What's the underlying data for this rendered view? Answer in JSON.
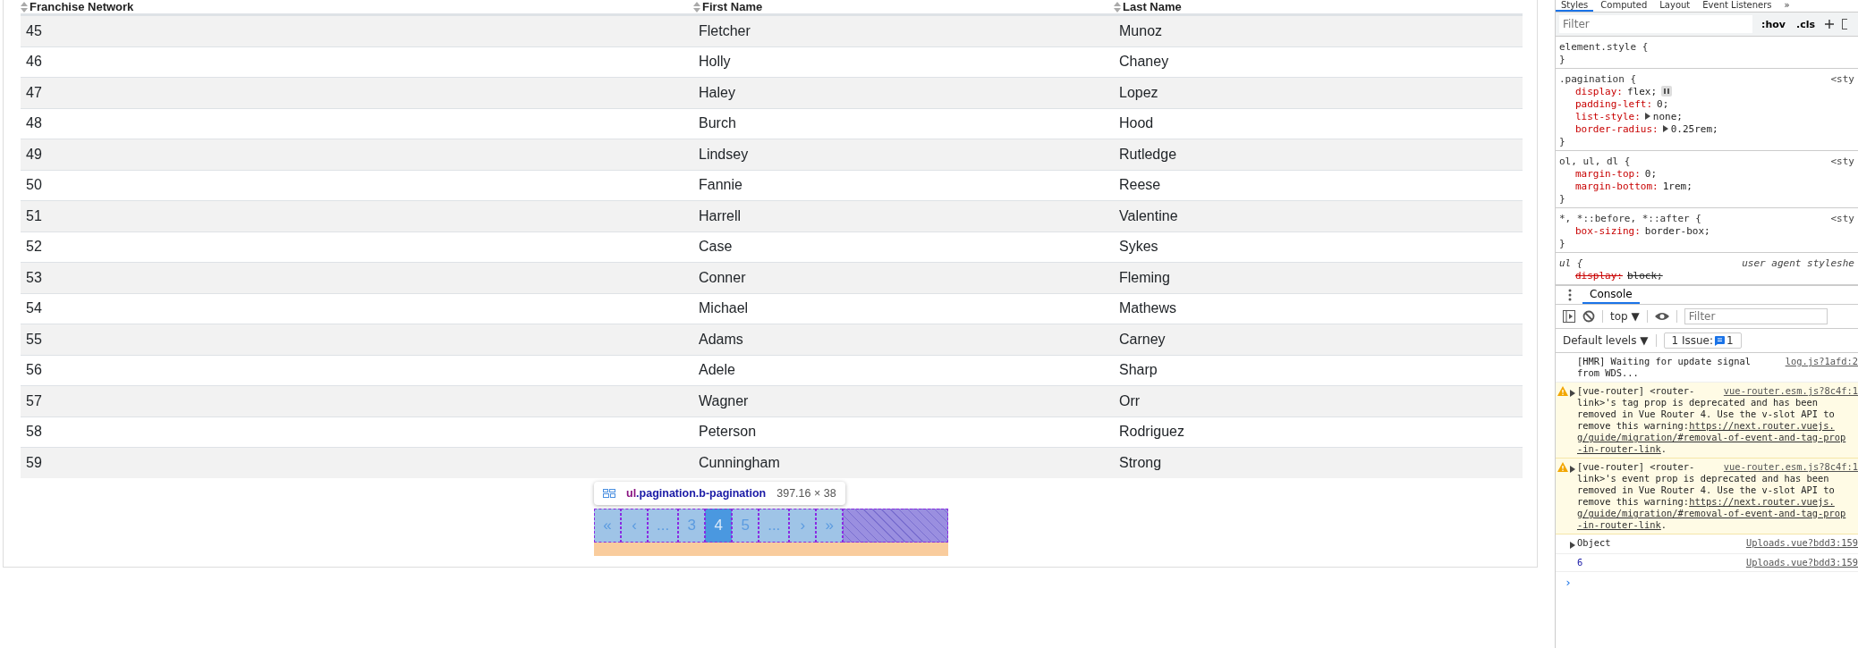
{
  "table": {
    "columns": [
      {
        "label": "Franchise Network"
      },
      {
        "label": "First Name"
      },
      {
        "label": "Last Name"
      }
    ],
    "rows": [
      [
        "45",
        "Fletcher",
        "Munoz"
      ],
      [
        "46",
        "Holly",
        "Chaney"
      ],
      [
        "47",
        "Haley",
        "Lopez"
      ],
      [
        "48",
        "Burch",
        "Hood"
      ],
      [
        "49",
        "Lindsey",
        "Rutledge"
      ],
      [
        "50",
        "Fannie",
        "Reese"
      ],
      [
        "51",
        "Harrell",
        "Valentine"
      ],
      [
        "52",
        "Case",
        "Sykes"
      ],
      [
        "53",
        "Conner",
        "Fleming"
      ],
      [
        "54",
        "Michael",
        "Mathews"
      ],
      [
        "55",
        "Adams",
        "Carney"
      ],
      [
        "56",
        "Adele",
        "Sharp"
      ],
      [
        "57",
        "Wagner",
        "Orr"
      ],
      [
        "58",
        "Peterson",
        "Rodriguez"
      ],
      [
        "59",
        "Cunningham",
        "Strong"
      ]
    ]
  },
  "pagination": {
    "items": [
      {
        "label": "«",
        "selected": false
      },
      {
        "label": "‹",
        "selected": false
      },
      {
        "label": "...",
        "selected": false
      },
      {
        "label": "3",
        "selected": false
      },
      {
        "label": "4",
        "selected": true
      },
      {
        "label": "5",
        "selected": false
      },
      {
        "label": "...",
        "selected": false
      },
      {
        "label": "›",
        "selected": false
      },
      {
        "label": "»",
        "selected": false
      }
    ]
  },
  "inspector_tooltip": {
    "tag": "ul",
    "classes": ".pagination.b-pagination",
    "size": "397.16 × 38"
  },
  "devtools": {
    "tabs": [
      {
        "label": "Styles",
        "selected": true
      },
      {
        "label": "Computed",
        "selected": false
      },
      {
        "label": "Layout",
        "selected": false
      },
      {
        "label": "Event Listeners",
        "selected": false
      },
      {
        "label": "»",
        "selected": false
      }
    ],
    "styles_filter": {
      "placeholder": "Filter"
    },
    "hov": ":hov",
    "cls": ".cls",
    "rules": [
      {
        "selector": "element.style {",
        "italic": false,
        "close": "}"
      },
      {
        "selector": ".pagination {",
        "source": "<sty",
        "italic": false,
        "close": "}",
        "declarations": [
          {
            "name": "display:",
            "value": "flex;",
            "expandable": false,
            "flex_badge": true,
            "overridden": false
          },
          {
            "name": "padding-left:",
            "value": "0;",
            "expandable": false,
            "flex_badge": false,
            "overridden": false
          },
          {
            "name": "list-style:",
            "value": "none;",
            "expandable": true,
            "flex_badge": false,
            "overridden": false
          },
          {
            "name": "border-radius:",
            "value": "0.25rem;",
            "expandable": true,
            "flex_badge": false,
            "overridden": false
          }
        ]
      },
      {
        "selector": "ol, ul, dl {",
        "source": "<sty",
        "italic": false,
        "close": "}",
        "declarations": [
          {
            "name": "margin-top:",
            "value": "0;",
            "expandable": false,
            "flex_badge": false,
            "overridden": false
          },
          {
            "name": "margin-bottom:",
            "value": "1rem;",
            "expandable": false,
            "flex_badge": false,
            "overridden": false
          }
        ]
      },
      {
        "selector": "*, *::before, *::after {",
        "source": "<sty",
        "italic": false,
        "close": "}",
        "declarations": [
          {
            "name": "box-sizing:",
            "value": "border-box;",
            "expandable": false,
            "flex_badge": false,
            "overridden": false
          }
        ]
      },
      {
        "selector": "ul {",
        "source": "user agent styleshe",
        "italic": true,
        "declarations": [
          {
            "name": "display:",
            "value": "block;",
            "expandable": false,
            "flex_badge": false,
            "overridden": true
          }
        ]
      }
    ],
    "console_tab": {
      "label": "Console",
      "selected": true
    },
    "context": "top ▼",
    "console_filter": {
      "placeholder": "Filter"
    },
    "levels": "Default levels ▼",
    "issues": {
      "label": "1 Issue:",
      "count": "1"
    },
    "messages": [
      {
        "kind": "log",
        "expandable": false,
        "source": "log.js?1afd:2",
        "lines": [
          [
            {
              "text": "[HMR] Waiting for update signal",
              "link": false
            }
          ],
          [
            {
              "text": "from WDS...",
              "link": false
            }
          ]
        ]
      },
      {
        "kind": "warning",
        "expandable": true,
        "source": "vue-router.esm.js?8c4f:1",
        "lines": [
          [
            {
              "text": "[vue-router] <router-",
              "link": false
            }
          ],
          [
            {
              "text": "link>'s tag prop is deprecated and has been",
              "link": false
            }
          ],
          [
            {
              "text": "removed in Vue Router 4. Use the v-slot API to",
              "link": false
            }
          ],
          [
            {
              "text": "remove this warning: ",
              "link": false
            },
            {
              "text": "https://next.router.vuejs.",
              "link": true
            }
          ],
          [
            {
              "text": "g/guide/migration/#removal-of-event-and-tag-prop",
              "link": true
            }
          ],
          [
            {
              "text": "-in-router-link",
              "link": true
            },
            {
              "text": ".",
              "link": false
            }
          ]
        ]
      },
      {
        "kind": "warning",
        "expandable": true,
        "source": "vue-router.esm.js?8c4f:1",
        "lines": [
          [
            {
              "text": "[vue-router] <router-",
              "link": false
            }
          ],
          [
            {
              "text": "link>'s event prop is deprecated and has been",
              "link": false
            }
          ],
          [
            {
              "text": "removed in Vue Router 4. Use the v-slot API to",
              "link": false
            }
          ],
          [
            {
              "text": "remove this warning: ",
              "link": false
            },
            {
              "text": "https://next.router.vuejs.",
              "link": true
            }
          ],
          [
            {
              "text": "g/guide/migration/#removal-of-event-and-tag-prop",
              "link": true
            }
          ],
          [
            {
              "text": "-in-router-link",
              "link": true
            },
            {
              "text": ".",
              "link": false
            }
          ]
        ]
      },
      {
        "kind": "object",
        "expandable": true,
        "source": "Uploads.vue?bdd3:159",
        "lines": [
          [
            {
              "text": "Object",
              "link": false
            }
          ]
        ]
      },
      {
        "kind": "number",
        "expandable": false,
        "source": "Uploads.vue?bdd3:159",
        "lines": [
          [
            {
              "text": "6",
              "link": false
            }
          ]
        ]
      }
    ],
    "prompt": "›"
  }
}
